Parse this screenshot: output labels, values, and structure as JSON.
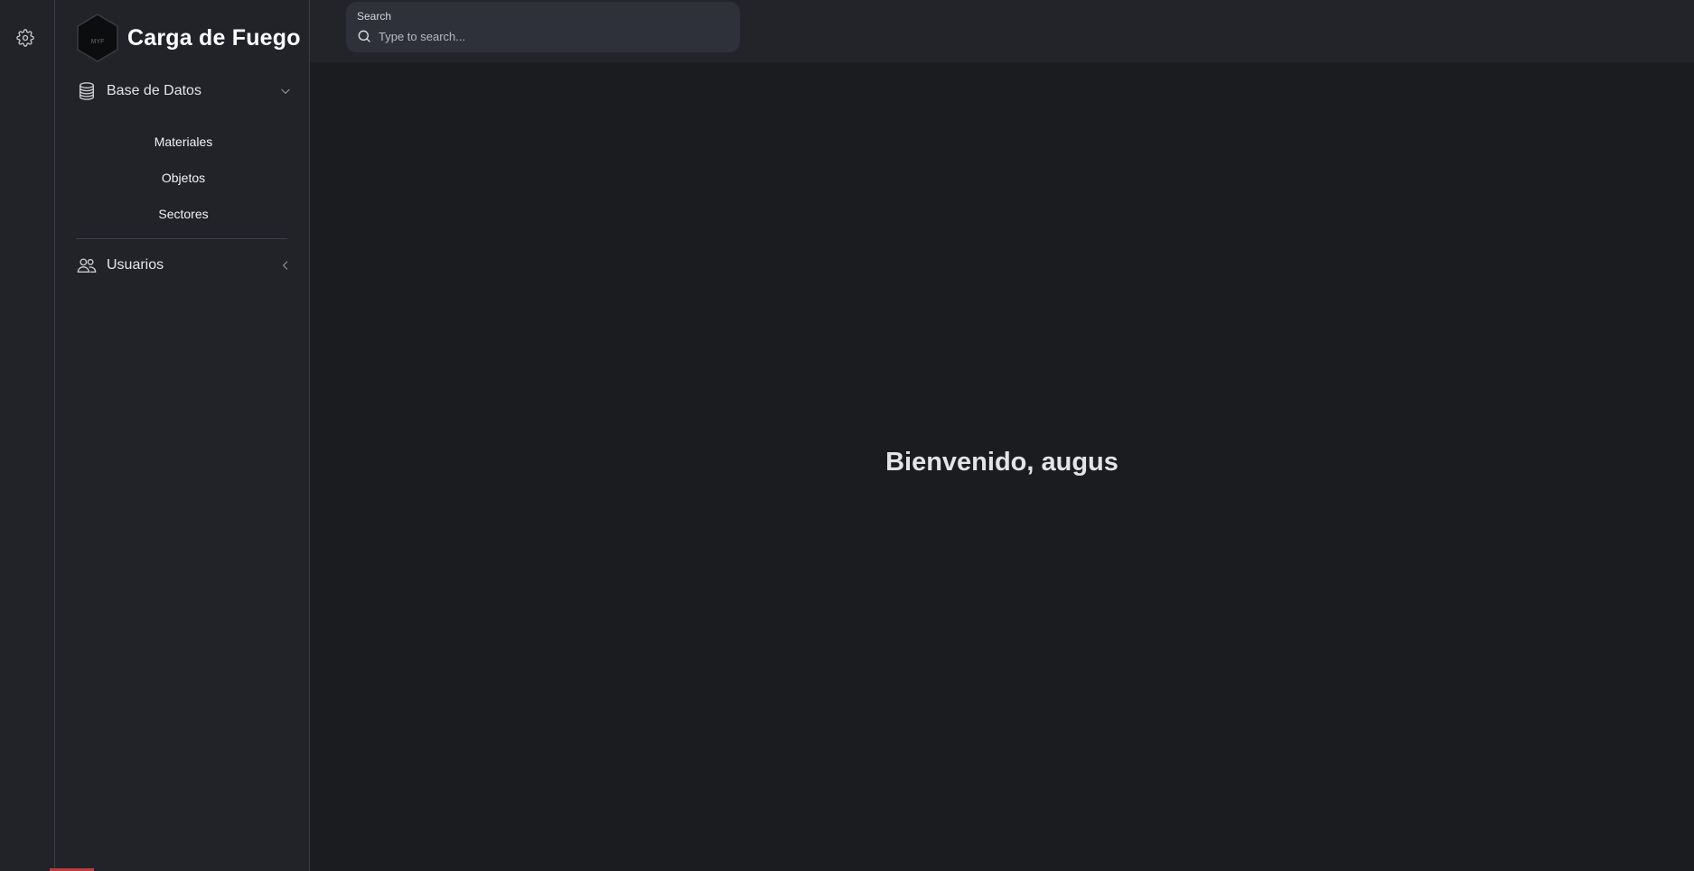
{
  "app": {
    "title": "Carga de Fuego",
    "logo_text": "MYF"
  },
  "rail": {
    "settings_icon": "gear-icon"
  },
  "sidebar": {
    "groups": [
      {
        "label": "Base de Datos",
        "icon": "database-icon",
        "expanded": true,
        "items": [
          "Materiales",
          "Objetos",
          "Sectores"
        ]
      },
      {
        "label": "Usuarios",
        "icon": "users-icon",
        "expanded": false,
        "items": []
      }
    ]
  },
  "search": {
    "caption": "Search",
    "placeholder": "Type to search...",
    "value": ""
  },
  "main": {
    "welcome": "Bienvenido, augus"
  },
  "colors": {
    "background": "#1b1c20",
    "sidebar": "#212328",
    "topbar": "#222429",
    "search_bg": "#2f313a",
    "accent_red": "#c23b3b"
  }
}
